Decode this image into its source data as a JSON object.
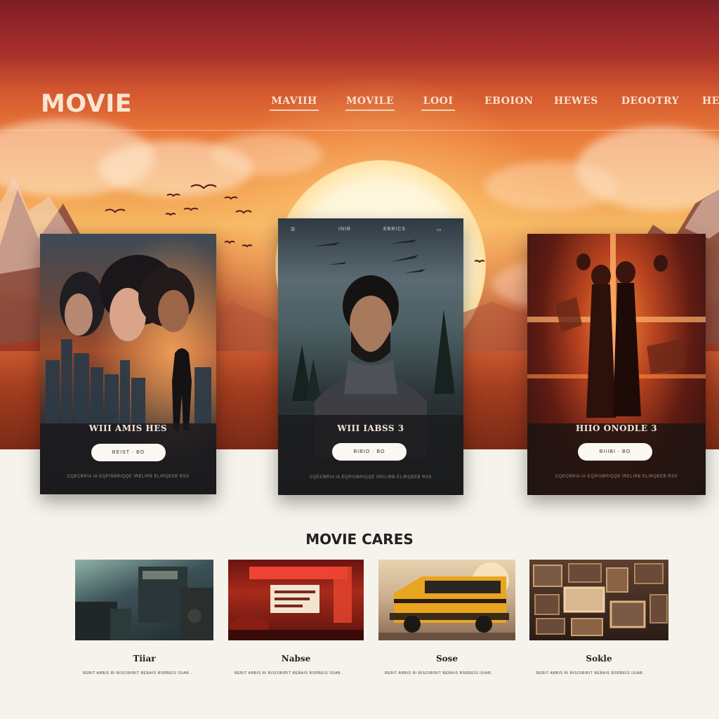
{
  "brand": "MOVIE",
  "nav": [
    {
      "label": "MAVIIH"
    },
    {
      "label": "MOVILE"
    },
    {
      "label": "LOOI"
    },
    {
      "label": "EBOION"
    },
    {
      "label": "HEWES"
    },
    {
      "label": "DEOOTRY"
    },
    {
      "label": "HE"
    }
  ],
  "posters": [
    {
      "title": "WIII AMIS HES",
      "button": "BEIST · BO",
      "credits": "CQECBRIA IA EQPISBRIQQE IRELIRB ELIRQEEB RSS"
    },
    {
      "top_left": "☰",
      "top_mid_1": "INIB",
      "top_mid_2": "EBRICS",
      "top_right": "▭",
      "title": "WIII IABSS 3",
      "button": "BIBIO · BO",
      "credits": "CQECBRIA IA EQPISBRIQQE IRELIRB ELIRQEEB RSS"
    },
    {
      "title": "HIIO ONODLE 3",
      "button": "BIIIBI · BO",
      "credits": "CQECBRIA IA EQPISBRIQQE IRELIRB ELIRQEEB RSS"
    }
  ],
  "section": {
    "title": "MOVIE CARES"
  },
  "cards": [
    {
      "label": "Tiiar",
      "desc": "BEBIT ABBIS RI BISOIBIRIT BEBAIS BSRBEIS ISIAB ."
    },
    {
      "label": "Nabse",
      "desc": "BEBIT ABBIS RI BISOIBIRIT BEBAIS BSRBEIS ISIAB ."
    },
    {
      "label": "Sose",
      "desc": "BEBIT ABBIS RI BISOIBIRIT BEBAIS BSRBEIS ISIAB ."
    },
    {
      "label": "Sokle",
      "desc": "BEBIT ABBIS RI BISOIBIRIT BEBAIS BSRBEIS ISIAB ."
    }
  ]
}
